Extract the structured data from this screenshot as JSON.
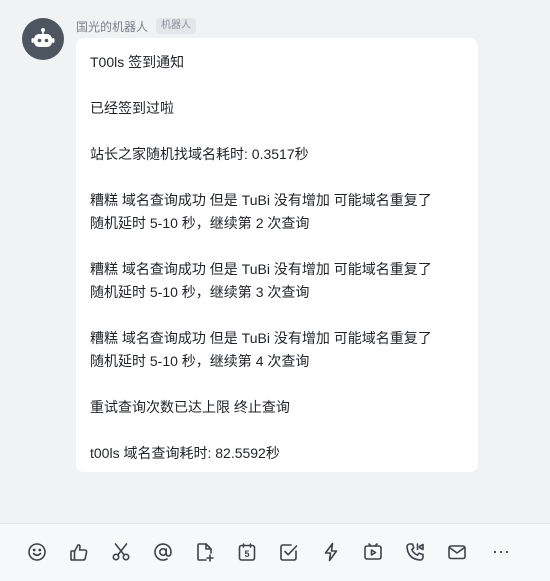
{
  "sender": {
    "name": "国光的机器人",
    "tag": "机器人"
  },
  "message": {
    "lines": [
      "T00ls 签到通知",
      "",
      "已经签到过啦",
      "",
      "站长之家随机找域名耗时: 0.3517秒",
      "",
      "糟糕 域名查询成功 但是 TuBi 没有增加 可能域名重复了",
      "随机延时 5-10 秒，继续第 2 次查询",
      "",
      "糟糕 域名查询成功 但是 TuBi 没有增加 可能域名重复了",
      "随机延时 5-10 秒，继续第 3 次查询",
      "",
      "糟糕 域名查询成功 但是 TuBi 没有增加 可能域名重复了",
      "随机延时 5-10 秒，继续第 4 次查询",
      "",
      "重试查询次数已达上限 终止查询",
      "",
      "t00ls 域名查询耗时: 82.5592秒"
    ]
  },
  "toolbar": {
    "items": [
      {
        "icon": "emoji-icon"
      },
      {
        "icon": "thumbs-up-icon"
      },
      {
        "icon": "scissors-icon"
      },
      {
        "icon": "at-icon"
      },
      {
        "icon": "add-file-icon"
      },
      {
        "icon": "calendar-icon",
        "badge": "5"
      },
      {
        "icon": "task-check-icon"
      },
      {
        "icon": "lightning-icon"
      },
      {
        "icon": "video-icon"
      },
      {
        "icon": "phone-icon"
      },
      {
        "icon": "mail-icon"
      },
      {
        "icon": "more-icon"
      }
    ]
  },
  "colors": {
    "background": "#f1f2f4",
    "bubble": "#ffffff",
    "text": "#1f2329",
    "avatar": "#4d5560"
  }
}
